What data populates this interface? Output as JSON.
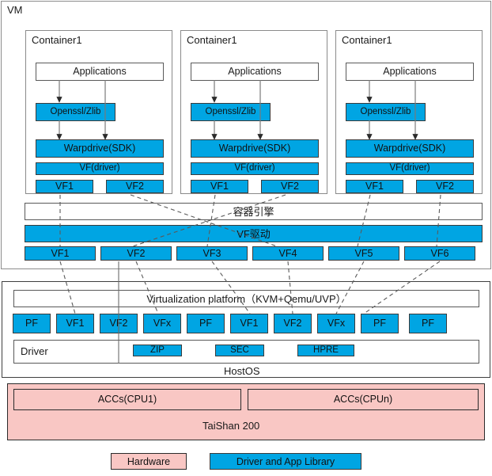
{
  "diagram": {
    "title": "VM",
    "vm_label": "VM",
    "container_engine_label": "容器引擎",
    "vf_driver_label": "VF驱动",
    "virtualization_platform_label": "Virtualization platform（KVM+Qemu/UVP）",
    "driver_label": "Driver",
    "hostos_label": "HostOS",
    "taishan_label": "TaiShan 200"
  },
  "containers": [
    {
      "title": "Container1",
      "applications": "Applications",
      "openssl": "Openssl/Zlib",
      "warpdrive": "Warpdrive(SDK)",
      "vf_driver": "VF(driver)",
      "vfs": [
        "VF1",
        "VF2"
      ]
    },
    {
      "title": "Container1",
      "applications": "Applications",
      "openssl": "Openssl/Zlib",
      "warpdrive": "Warpdrive(SDK)",
      "vf_driver": "VF(driver)",
      "vfs": [
        "VF1",
        "VF2"
      ]
    },
    {
      "title": "Container1",
      "applications": "Applications",
      "openssl": "Openssl/Zlib",
      "warpdrive": "Warpdrive(SDK)",
      "vf_driver": "VF(driver)",
      "vfs": [
        "VF1",
        "VF2"
      ]
    }
  ],
  "vm_vf_row": [
    "VF1",
    "VF2",
    "VF3",
    "VF4",
    "VF5",
    "VF6"
  ],
  "host_function_row": [
    "PF",
    "VF1",
    "VF2",
    "VFx",
    "PF",
    "VF1",
    "VF2",
    "VFx",
    "PF",
    "PF"
  ],
  "driver_modules": [
    "ZIP",
    "SEC",
    "HPRE"
  ],
  "accelerators": [
    "ACCs(CPU1)",
    "ACCs(CPUn)"
  ],
  "legend": [
    {
      "label": "Hardware",
      "color": "#f9c7c4"
    },
    {
      "label": "Driver and App Library",
      "color": "#00a5e3"
    }
  ],
  "colors": {
    "blue": "#00a5e3",
    "pink": "#f9c7c4",
    "white": "#ffffff",
    "border": "#3f3f3f",
    "dashed": "#555555"
  }
}
